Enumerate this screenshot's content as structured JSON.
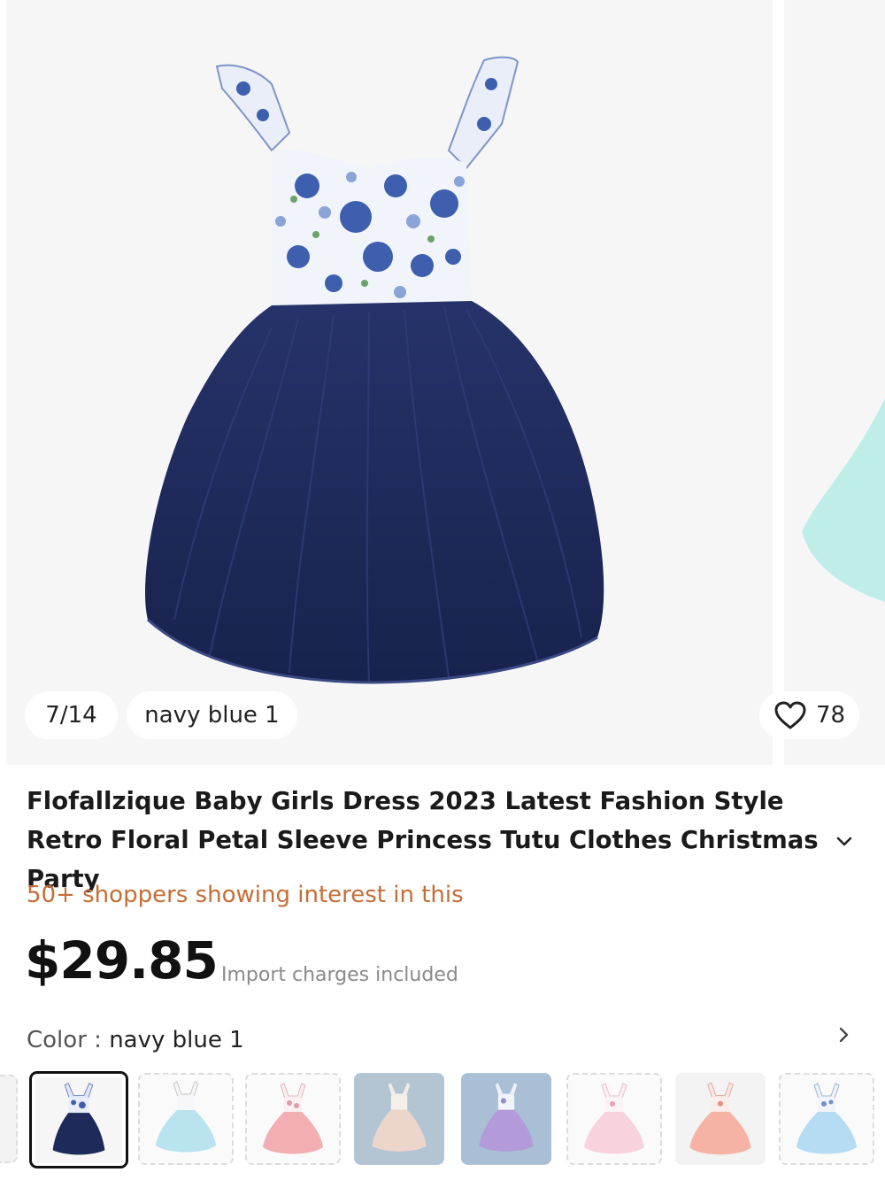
{
  "gallery": {
    "counter": "7/14",
    "variant_label": "navy blue 1",
    "likes": "78",
    "like_icon": "heart-outline-icon"
  },
  "product": {
    "title": "Flofallzique Baby Girls Dress 2023 Latest Fashion Style Retro Floral Petal Sleeve Princess Tutu Clothes Christmas Party",
    "expand_icon": "chevron-down-icon",
    "interest_text": "50+ shoppers showing interest in this",
    "price": "$29.85",
    "import_note": "Import charges included"
  },
  "color": {
    "label": "Color",
    "separator": " : ",
    "value": "navy blue 1",
    "more_icon": "chevron-right-icon"
  },
  "thumbnails": [
    {
      "variant": "navy blue 1",
      "selected": true
    },
    {
      "variant": "light blue",
      "selected": false
    },
    {
      "variant": "pink floral",
      "selected": false
    },
    {
      "variant": "champagne",
      "selected": false
    },
    {
      "variant": "purple",
      "selected": false
    },
    {
      "variant": "light pink",
      "selected": false
    },
    {
      "variant": "peach",
      "selected": false
    },
    {
      "variant": "sky blue",
      "selected": false
    }
  ],
  "colors": {
    "accent_interest": "#c56d35",
    "navy_skirt": "#1e2a5a",
    "selected_border": "#111111"
  }
}
